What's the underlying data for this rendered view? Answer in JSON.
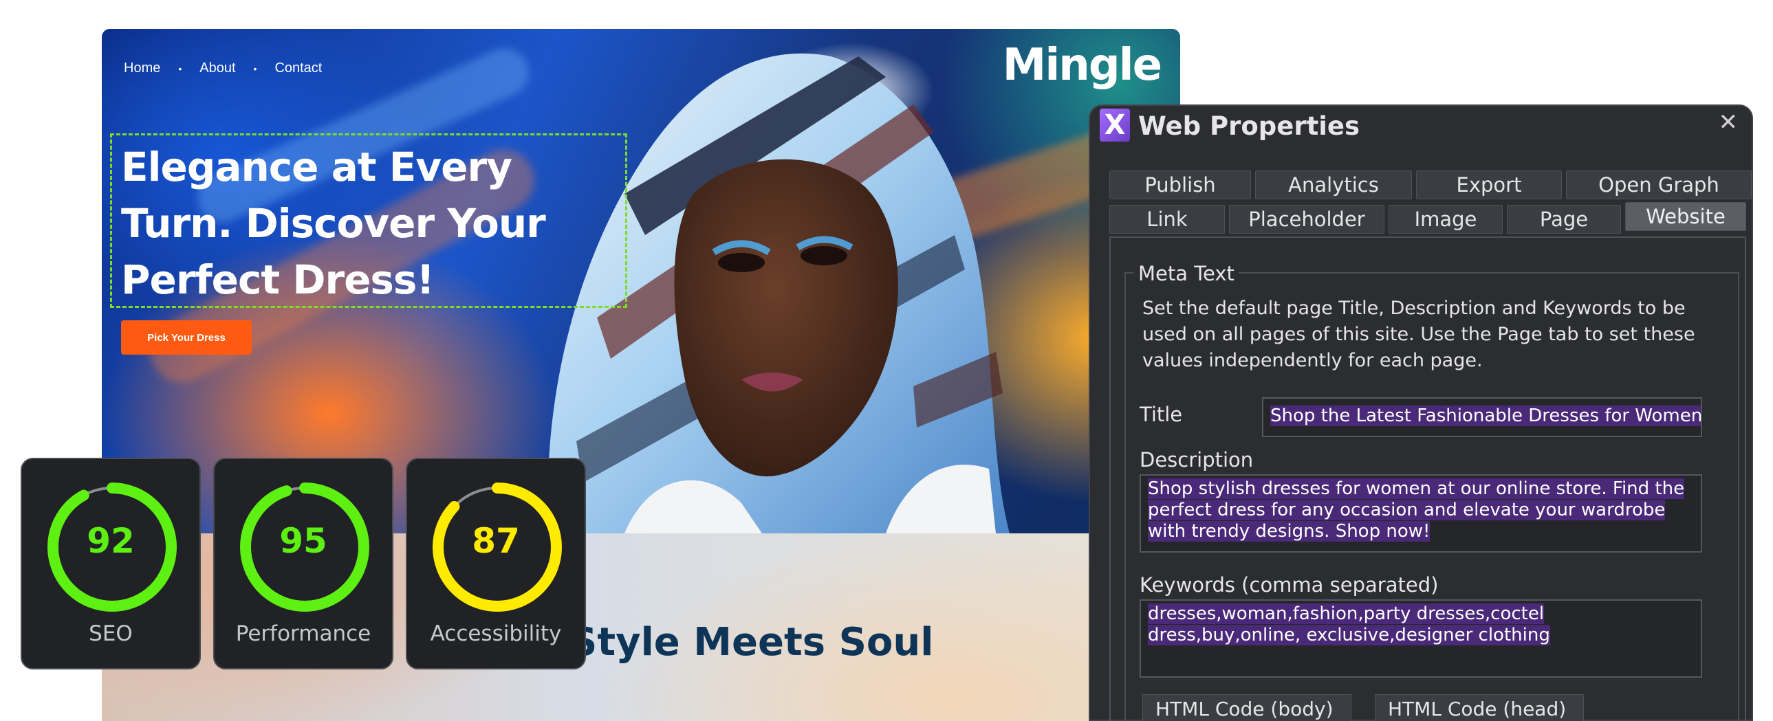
{
  "site": {
    "nav": {
      "home": "Home",
      "about": "About",
      "contact": "Contact",
      "separator": "•"
    },
    "logo": "Mingle",
    "headline": "Elegance at Every Turn. Discover Your Perfect Dress!",
    "cta_label": "Pick Your Dress",
    "section_title": "Style Meets Soul",
    "colors": {
      "cta": "#ff5a12",
      "headline_box": "#7ddc2b",
      "section_title": "#0e3557"
    }
  },
  "scores": [
    {
      "label": "SEO",
      "value": "92",
      "fraction": 0.92,
      "color": "#5ef012"
    },
    {
      "label": "Performance",
      "value": "95",
      "fraction": 0.95,
      "color": "#5ef012"
    },
    {
      "label": "Accessibility",
      "value": "87",
      "fraction": 0.87,
      "color": "#ffeb00"
    }
  ],
  "dialog": {
    "title": "Web Properties",
    "icon": "X",
    "close": "✕",
    "tabs_row1": [
      "Publish",
      "Analytics",
      "Export",
      "Open Graph"
    ],
    "tabs_row2": [
      "Link",
      "Placeholder",
      "Image",
      "Page",
      "Website"
    ],
    "active_tab": "Website",
    "group_label": "Meta Text",
    "group_description": "Set the default page Title, Description and Keywords to be used on all pages of this site. Use the Page tab to set these values independently for each page.",
    "title_label": "Title",
    "title_value": "Shop the Latest Fashionable Dresses for Women...",
    "description_label": "Description",
    "description_value": "Shop stylish dresses for women at our online store. Find the perfect dress for any occasion and elevate your wardrobe with trendy designs. Shop now!",
    "keywords_label": "Keywords (comma separated)",
    "keywords_value": "dresses,woman,fashion,party dresses,coctel dress,buy,online, exclusive,designer clothing",
    "html_body_button": "HTML Code (body)",
    "html_head_button": "HTML Code (head)"
  }
}
